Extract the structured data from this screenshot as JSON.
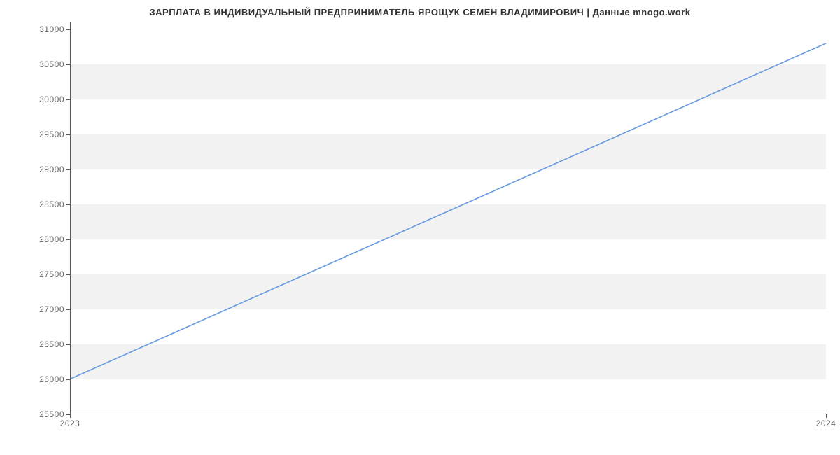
{
  "chart_data": {
    "type": "line",
    "title": "ЗАРПЛАТА В ИНДИВИДУАЛЬНЫЙ ПРЕДПРИНИМАТЕЛЬ ЯРОЩУК СЕМЕН ВЛАДИМИРОВИЧ | Данные mnogo.work",
    "x": [
      2023,
      2024
    ],
    "values": [
      26000,
      30800
    ],
    "x_ticks": [
      2023,
      2024
    ],
    "y_ticks": [
      25500,
      26000,
      26500,
      27000,
      27500,
      28000,
      28500,
      29000,
      29500,
      30000,
      30500,
      31000
    ],
    "xlim": [
      2023,
      2024
    ],
    "ylim": [
      25500,
      31100
    ],
    "line_color": "#6699e0",
    "band_color": "#f2f2f2"
  }
}
